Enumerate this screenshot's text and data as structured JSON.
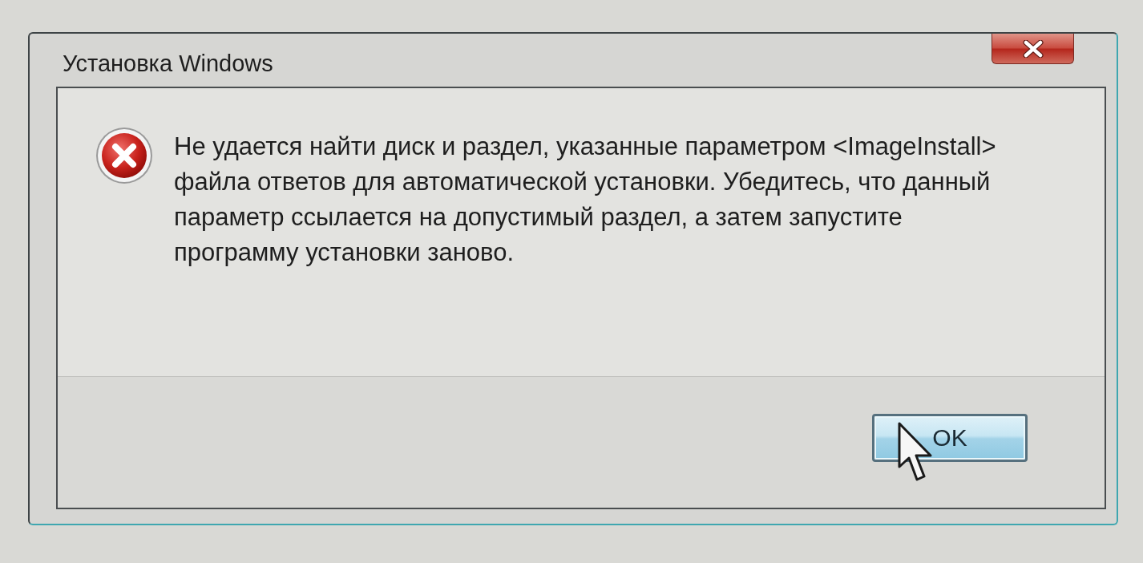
{
  "window": {
    "title": "Установка Windows"
  },
  "message": {
    "kind": "error",
    "lines": [
      "Не удается найти диск и раздел, указанные параметром <ImageInstall>",
      "файла ответов для автоматической установки. Убедитесь, что данный",
      "параметр ссылается на допустимый раздел, а затем запустите",
      "программу установки заново."
    ]
  },
  "buttons": [
    {
      "label": "OK",
      "hovered": true
    }
  ]
}
